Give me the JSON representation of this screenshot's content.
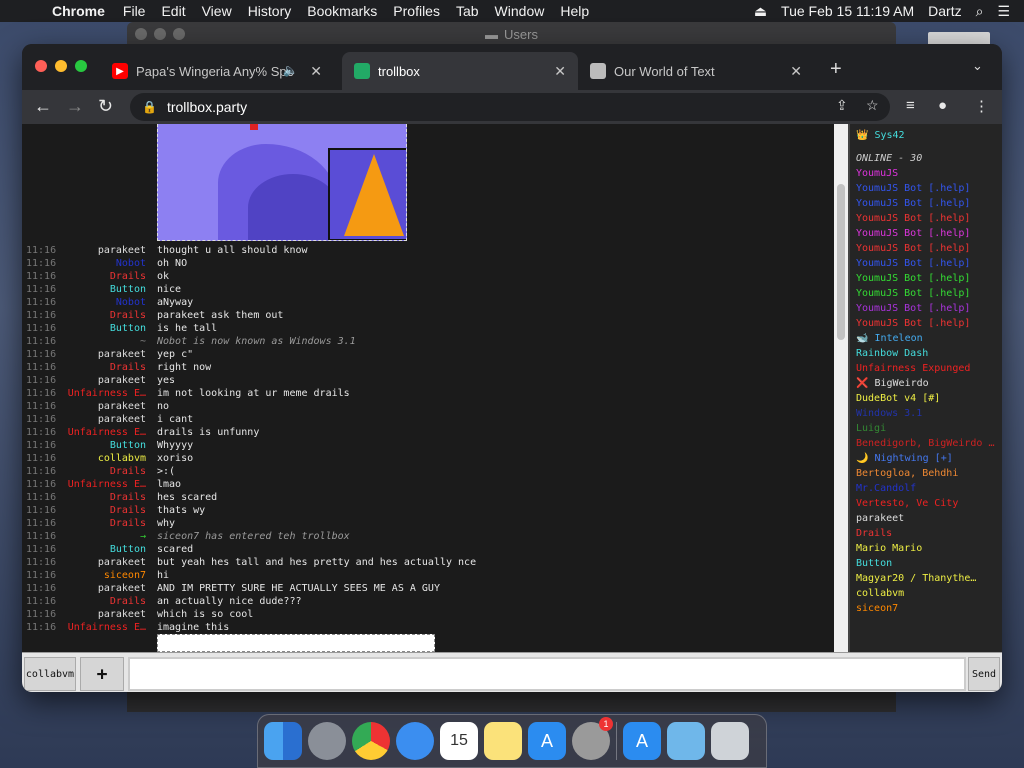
{
  "menubar": {
    "app": "Chrome",
    "items": [
      "File",
      "Edit",
      "View",
      "History",
      "Bookmarks",
      "Profiles",
      "Tab",
      "Window",
      "Help"
    ],
    "datetime": "Tue Feb 15  11:19 AM",
    "user": "Dartz"
  },
  "bg_window": {
    "title": "Users"
  },
  "tabs": [
    {
      "label": "Papa's Wingeria Any% Spe",
      "fav_color": "#ff0000"
    },
    {
      "label": "trollbox",
      "fav_color": "#3a7"
    },
    {
      "label": "Our World of Text",
      "fav_color": "#ccc"
    }
  ],
  "omnibox": {
    "url": "trollbox.party"
  },
  "messages": [
    {
      "time": "11:16",
      "nick": "parakeet",
      "color": "#dddddd",
      "text": "thought u all should know"
    },
    {
      "time": "11:16",
      "nick": "Nobot",
      "color": "#2233cc",
      "text": "oh NO"
    },
    {
      "time": "11:16",
      "nick": "Drails",
      "color": "#ee3333",
      "text": "ok"
    },
    {
      "time": "11:16",
      "nick": "Button",
      "color": "#44dddd",
      "text": "nice"
    },
    {
      "time": "11:16",
      "nick": "Nobot",
      "color": "#2233cc",
      "text": "aNyway"
    },
    {
      "time": "11:16",
      "nick": "Drails",
      "color": "#ee3333",
      "text": "parakeet ask them out"
    },
    {
      "time": "11:16",
      "nick": "Button",
      "color": "#44dddd",
      "text": "is he tall"
    },
    {
      "time": "11:16",
      "nick": "~",
      "color": "#888888",
      "text": "Nobot is now known as Windows 3.1",
      "sys": true
    },
    {
      "time": "11:16",
      "nick": "parakeet",
      "color": "#dddddd",
      "text": "yep c\""
    },
    {
      "time": "11:16",
      "nick": "Drails",
      "color": "#ee3333",
      "text": "right now"
    },
    {
      "time": "11:16",
      "nick": "parakeet",
      "color": "#dddddd",
      "text": "yes"
    },
    {
      "time": "11:16",
      "nick": "Unfairness E…",
      "color": "#ee2222",
      "text": "im not looking at ur meme drails"
    },
    {
      "time": "11:16",
      "nick": "parakeet",
      "color": "#dddddd",
      "text": "no"
    },
    {
      "time": "11:16",
      "nick": "parakeet",
      "color": "#dddddd",
      "text": "i cant"
    },
    {
      "time": "11:16",
      "nick": "Unfairness E…",
      "color": "#ee2222",
      "text": "drails is unfunny"
    },
    {
      "time": "11:16",
      "nick": "Button",
      "color": "#44dddd",
      "text": "Whyyyy"
    },
    {
      "time": "11:16",
      "nick": "collabvm",
      "color": "#eeee44",
      "text": "xoriso"
    },
    {
      "time": "11:16",
      "nick": "Drails",
      "color": "#ee3333",
      "text": ">:("
    },
    {
      "time": "11:16",
      "nick": "Unfairness E…",
      "color": "#ee2222",
      "text": "lmao"
    },
    {
      "time": "11:16",
      "nick": "Drails",
      "color": "#ee3333",
      "text": "hes scared"
    },
    {
      "time": "11:16",
      "nick": "Drails",
      "color": "#ee3333",
      "text": "thats wy"
    },
    {
      "time": "11:16",
      "nick": "Drails",
      "color": "#ee3333",
      "text": "why"
    },
    {
      "time": "11:16",
      "nick": "→",
      "color": "#33cc33",
      "text": "siceon7 has entered teh trollbox",
      "sys": true
    },
    {
      "time": "11:16",
      "nick": "Button",
      "color": "#44dddd",
      "text": "scared"
    },
    {
      "time": "11:16",
      "nick": "parakeet",
      "color": "#dddddd",
      "text": "but yeah hes tall and hes pretty and hes actually nce"
    },
    {
      "time": "11:16",
      "nick": "siceon7",
      "color": "#ff8800",
      "text": "hi"
    },
    {
      "time": "11:16",
      "nick": "parakeet",
      "color": "#dddddd",
      "text": "AND IM PRETTY SURE HE ACTUALLY SEES ME AS A GUY"
    },
    {
      "time": "11:16",
      "nick": "Drails",
      "color": "#ee3333",
      "text": "an actually nice dude???"
    },
    {
      "time": "11:16",
      "nick": "parakeet",
      "color": "#dddddd",
      "text": "which is so cool"
    },
    {
      "time": "11:16",
      "nick": "Unfairness E…",
      "color": "#ee2222",
      "text": "imagine this"
    }
  ],
  "userlist": {
    "self": "👑 Sys42",
    "online_header": "ONLINE - 30",
    "users": [
      {
        "name": "YoumuJS",
        "color": "#dd33dd"
      },
      {
        "name": "YoumuJS Bot [.help]",
        "color": "#3355ee"
      },
      {
        "name": "YoumuJS Bot [.help]",
        "color": "#3355ee"
      },
      {
        "name": "YoumuJS Bot [.help]",
        "color": "#ee3333"
      },
      {
        "name": "YoumuJS Bot [.help]",
        "color": "#dd33dd"
      },
      {
        "name": "YoumuJS Bot [.help]",
        "color": "#ee3333"
      },
      {
        "name": "YoumuJS Bot [.help]",
        "color": "#3355ee"
      },
      {
        "name": "YoumuJS Bot [.help]",
        "color": "#33dd33"
      },
      {
        "name": "YoumuJS Bot [.help]",
        "color": "#33dd33"
      },
      {
        "name": "YoumuJS Bot [.help]",
        "color": "#aa33dd"
      },
      {
        "name": "YoumuJS Bot [.help]",
        "color": "#ee3333"
      },
      {
        "name": "🐋 Inteleon",
        "color": "#44aaee"
      },
      {
        "name": "Rainbow Dash",
        "color": "#44dddd"
      },
      {
        "name": "Unfairness Expunged",
        "color": "#ee2222"
      },
      {
        "name": "❌ BigWeirdo",
        "color": "#dddddd"
      },
      {
        "name": "DudeBot v4 [#]",
        "color": "#eeee44"
      },
      {
        "name": "Windows 3.1",
        "color": "#2233aa"
      },
      {
        "name": "Luigi",
        "color": "#338833"
      },
      {
        "name": "Benedigorb, BigWeirdo …",
        "color": "#cc2222"
      },
      {
        "name": "🌙 Nightwing [+]",
        "color": "#4477ee"
      },
      {
        "name": "Bertogloa, Behdhi",
        "color": "#ee8833"
      },
      {
        "name": "Mr.Candolf",
        "color": "#2233cc"
      },
      {
        "name": "Vertesto, Ve City",
        "color": "#ee2222"
      },
      {
        "name": "parakeet",
        "color": "#dddddd"
      },
      {
        "name": "Drails",
        "color": "#ee3333"
      },
      {
        "name": "Mario Mario",
        "color": "#eeee44"
      },
      {
        "name": "Button",
        "color": "#44dddd"
      },
      {
        "name": "Magyar20 / Thanythe…",
        "color": "#eeee44"
      },
      {
        "name": "collabvm",
        "color": "#eeee44"
      },
      {
        "name": "siceon7",
        "color": "#ff8800"
      }
    ]
  },
  "bottombar": {
    "room": "collabvm",
    "plus": "+",
    "send": "Send",
    "input_value": ""
  },
  "colors": {
    "accent": "#35363a",
    "page_bg": "#1b1b1b"
  }
}
